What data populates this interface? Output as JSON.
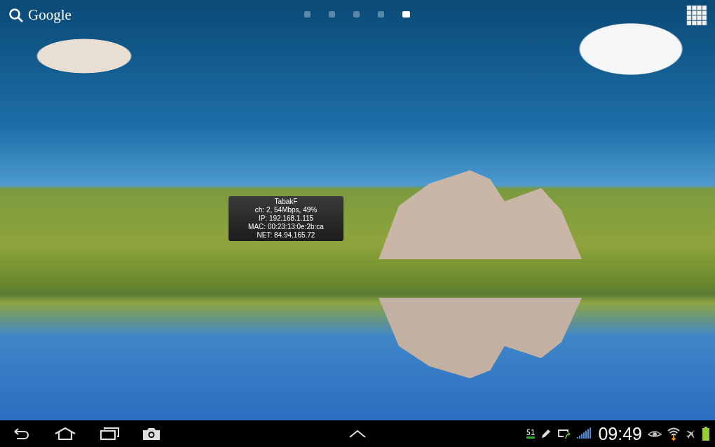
{
  "search": {
    "label": "Google"
  },
  "page_indicator": [
    {
      "selected": false
    },
    {
      "selected": false
    },
    {
      "selected": false
    },
    {
      "selected": false
    },
    {
      "selected": true
    }
  ],
  "wifi_widget": {
    "lines": [
      "TabakF",
      "ch: 2, 54Mbps, 49%",
      "IP: 192.168.1.115",
      "MAC: 00:23:13:0e:2b:ca",
      "NET: 84.94.165.72"
    ]
  },
  "system_bar": {
    "notification_text": "51",
    "clock": "09:49"
  }
}
